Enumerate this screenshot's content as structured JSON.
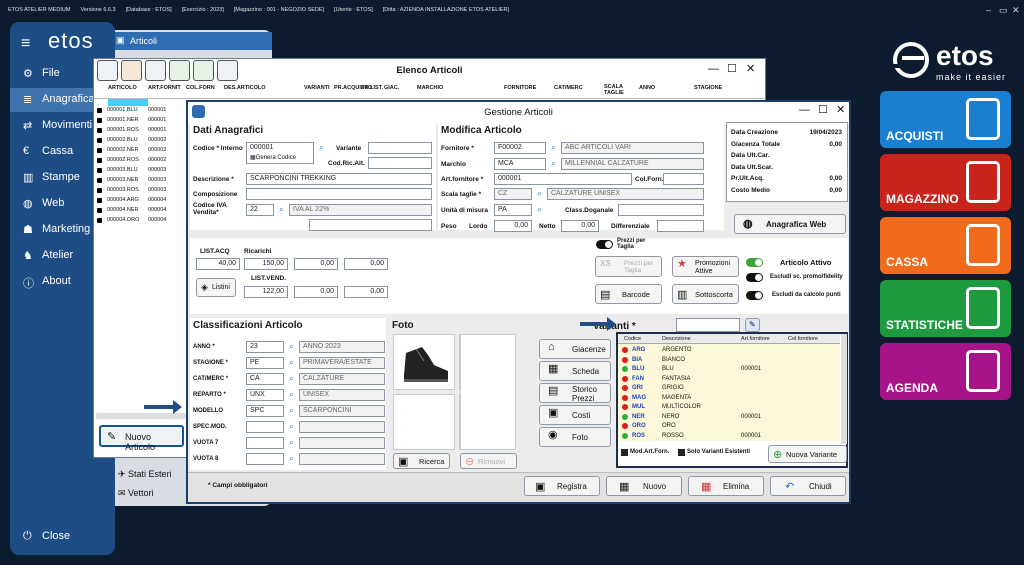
{
  "titlebar": [
    "ETOS ATELIER MEDIUM",
    "Versione 6.6.3",
    "[Database : ETOS]",
    "[Esercizio : 2023]",
    "[Magazzino : 001 - NEGOZIO SEDE]",
    "[Utente : ETOS]",
    "[Ditta : AZIENDA INSTALLAZIONE ETOS ATELIER]"
  ],
  "window_controls": {
    "min": "–",
    "max": "▭",
    "close": "✕"
  },
  "sidebar": {
    "logo": "etos",
    "items": [
      {
        "label": "File",
        "icon": "gear-icon",
        "glyph": "⚙"
      },
      {
        "label": "Anagrafica",
        "icon": "database-icon",
        "glyph": "≣"
      },
      {
        "label": "Movimenti",
        "icon": "arrows-icon",
        "glyph": "⇄"
      },
      {
        "label": "Cassa",
        "icon": "euro-icon",
        "glyph": "€"
      },
      {
        "label": "Stampe",
        "icon": "chart-icon",
        "glyph": "▥"
      },
      {
        "label": "Web",
        "icon": "globe-icon",
        "glyph": "◍"
      },
      {
        "label": "Marketing",
        "icon": "users-icon",
        "glyph": "☗"
      },
      {
        "label": "Atelier",
        "icon": "person-icon",
        "glyph": "♞"
      },
      {
        "label": "About",
        "icon": "info-icon",
        "glyph": "ⓘ"
      }
    ],
    "active": "Anagrafica",
    "close": "Close"
  },
  "subpanel": {
    "articoli": "Articoli",
    "stati_esteri": "Stati Esteri",
    "vettori": "Vettori"
  },
  "elenco": {
    "title": "Elenco Articoli",
    "columns": [
      "ARTICOLO",
      "ART.FORNIT",
      "COL.FORN",
      "DES.ARTICOLO",
      "VARIANTI",
      "PR.ACQUISTO",
      "PR.LIST.",
      "GIAC.",
      "MARCHIO",
      "FORNITORE",
      "CAT/MERC",
      "SCALA TAGLIE",
      "ANNO",
      "STAGIONE"
    ],
    "rows": [
      [
        "000001.BLU",
        "000001"
      ],
      [
        "000001.NER",
        "000001"
      ],
      [
        "000001.ROS",
        "000001"
      ],
      [
        "000002.BLU",
        "000002"
      ],
      [
        "000002.NER",
        "000002"
      ],
      [
        "000002.ROS",
        "000002"
      ],
      [
        "000003.BLU",
        "000003"
      ],
      [
        "000003.NER",
        "000003"
      ],
      [
        "000003.ROS",
        "000003"
      ],
      [
        "000004.ARG",
        "000004"
      ],
      [
        "000004.NER",
        "000004"
      ],
      [
        "000004.ORO",
        "000004"
      ]
    ],
    "nuovo_articolo": "Nuovo Articolo"
  },
  "gestione": {
    "title": "Gestione Articoli",
    "dati": {
      "heading": "Dati Anagrafici",
      "codice_label": "Codice * Interno",
      "codice": "000001",
      "genera": "Genera Codice",
      "variante_label": "Variante",
      "codricalt_label": "Cod.Ric.Alt.",
      "descrizione_label": "Descrizione *",
      "descrizione": "SCARPONCINI TREKKING",
      "composizione_label": "Composizione",
      "iva_label": "Codice IVA Vendita*",
      "iva_code": "22",
      "iva_desc": "IVA AL 22%"
    },
    "modifica": {
      "heading": "Modifica Articolo",
      "fornitore_label": "Fornitore *",
      "fornitore_code": "F00002",
      "fornitore_desc": "ABC ARTICOLI VARI",
      "marchio_label": "Marchio",
      "marchio_code": "MCA",
      "marchio_desc": "MILLENNIAL CALZATURE",
      "artforn_label": "Art.fornitore *",
      "artforn": "000001",
      "colforn_label": "Col.Forn.",
      "scala_label": "Scala taglie *",
      "scala_code": "CZ",
      "scala_desc": "CALZATURE UNISEX",
      "um_label": "Unità di misura",
      "um": "PA",
      "classdog_label": "Class.Doganale",
      "peso_label": "Peso",
      "lordo_label": "Lordo",
      "lordo": "0,00",
      "netto_label": "Netto",
      "netto": "0,00",
      "diff_label": "Differenziale"
    },
    "info": [
      {
        "label": "Data Creazione",
        "value": "19/04/2023"
      },
      {
        "label": "Giacenza Totale",
        "value": "0,00"
      },
      {
        "label": "Data Ult.Car.",
        "value": ""
      },
      {
        "label": "Data Ult.Scar.",
        "value": ""
      },
      {
        "label": "Pr.Ult.Acq.",
        "value": "0,00"
      },
      {
        "label": "Costo Medio",
        "value": "0,00"
      }
    ],
    "anagrafica_web": "Anagrafica Web",
    "prezzi": {
      "listacq_label": "LIST.ACQ",
      "listacq": "40,00",
      "ricarichi_label": "Ricarichi",
      "ric": [
        "150,00",
        "0,00",
        "0,00"
      ],
      "listvend_label": "LIST.VEND.",
      "vend": [
        "122,00",
        "0,00",
        "0,00"
      ],
      "listini": "Listini",
      "prezzi_taglie_label": "Prezzi per Taglia",
      "prezzi_taglia_btn": "Prezzi per Taglia",
      "promozioni": "Promozioni Attive",
      "barcode": "Barcode",
      "sottoscorta": "Sottoscorta",
      "attivo": "Articolo Attivo",
      "escludi_promo": "Escludi sc. promo/fidelity",
      "escludi_calc": "Escludi da calcolo punti"
    },
    "classificazioni": {
      "heading": "Classificazioni Articolo",
      "rows": [
        {
          "label": "ANNO *",
          "code": "23",
          "desc": "ANNO 2023"
        },
        {
          "label": "STAGIONE *",
          "code": "PE",
          "desc": "PRIMAVERA/ESTATE"
        },
        {
          "label": "CAT/MERC *",
          "code": "CA",
          "desc": "CALZATURE"
        },
        {
          "label": "REPARTO *",
          "code": "UNX",
          "desc": "UNISEX"
        },
        {
          "label": "MODELLO",
          "code": "SPC",
          "desc": "SCARPONCINI"
        },
        {
          "label": "SPEC.MOD.",
          "code": "",
          "desc": ""
        },
        {
          "label": "VUOTA 7",
          "code": "",
          "desc": ""
        },
        {
          "label": "VUOTA 8",
          "code": "",
          "desc": ""
        }
      ]
    },
    "foto": {
      "heading": "Foto",
      "ricerca": "Ricerca",
      "rimuovi": "Rimuovi"
    },
    "side_buttons": [
      "Giacenze",
      "Scheda",
      "Storico Prezzi",
      "Costi",
      "Foto"
    ],
    "varianti": {
      "heading": "Varianti *",
      "columns": [
        "Codice",
        "Descrizione",
        "Art.fornitore",
        "Col.fornitore"
      ],
      "rows": [
        {
          "code": "ARG",
          "desc": "ARGENTO",
          "art": ""
        },
        {
          "code": "BIA",
          "desc": "BIANCO",
          "art": ""
        },
        {
          "code": "BLU",
          "desc": "BLU",
          "art": "000001"
        },
        {
          "code": "FAN",
          "desc": "FANTASIA",
          "art": ""
        },
        {
          "code": "GRI",
          "desc": "GRIGIO",
          "art": ""
        },
        {
          "code": "MAG",
          "desc": "MAGENTA",
          "art": ""
        },
        {
          "code": "MUL",
          "desc": "MULTICOLOR",
          "art": ""
        },
        {
          "code": "NER",
          "desc": "NERO",
          "art": "000001"
        },
        {
          "code": "ORO",
          "desc": "ORO",
          "art": ""
        },
        {
          "code": "ROS",
          "desc": "ROSSO",
          "art": "000001"
        }
      ],
      "mod_art_forn": "Mod.Art.Forn.",
      "solo_esistenti": "Solo Varianti Esistenti",
      "nuova": "Nuova Variante"
    },
    "campi": "* Campi obbligatori",
    "bottom": [
      "Registra",
      "Nuovo",
      "Elimina",
      "Chiudi"
    ]
  },
  "brand": {
    "name": "etos",
    "tagline": "make it easier"
  },
  "tiles": [
    {
      "label": "ACQUISTI",
      "color": "#1a7fd0",
      "icon": "shopping-bag-icon"
    },
    {
      "label": "MAGAZZINO",
      "color": "#c8241c",
      "icon": "warehouse-cart-icon"
    },
    {
      "label": "CASSA",
      "color": "#f26a1b",
      "icon": "receipt-icon"
    },
    {
      "label": "STATISTICHE",
      "color": "#1e9a3f",
      "icon": "stats-chart-icon"
    },
    {
      "label": "AGENDA",
      "color": "#a7148a",
      "icon": "agenda-icon"
    }
  ]
}
